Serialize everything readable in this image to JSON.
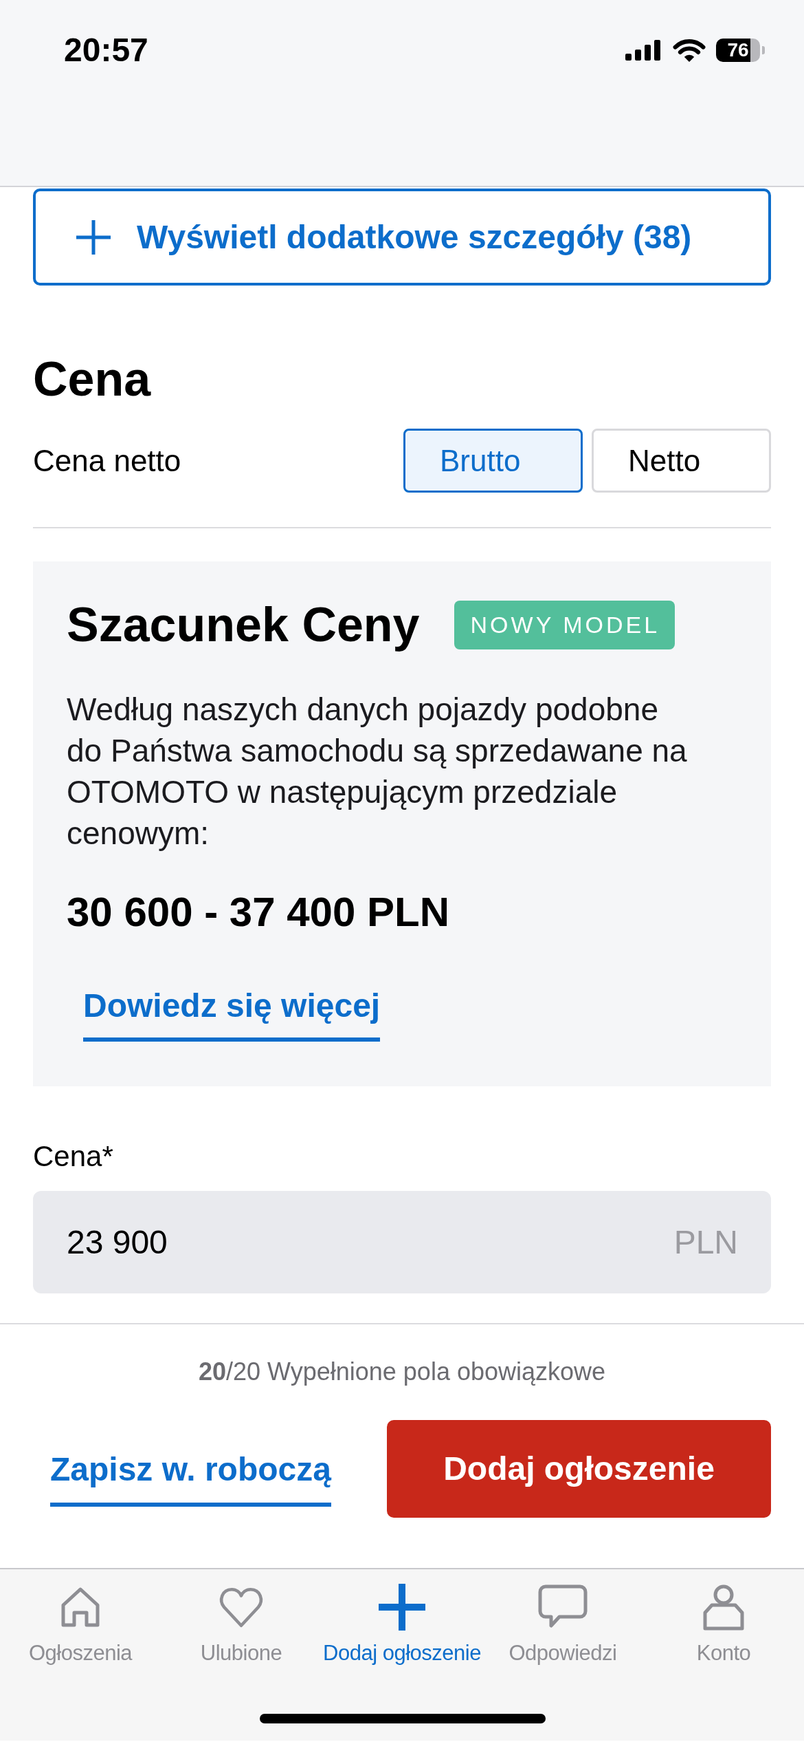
{
  "status_bar": {
    "time": "20:57",
    "battery": "76"
  },
  "details_button": {
    "label": "Wyświetl dodatkowe szczegóły (38)"
  },
  "price_section": {
    "title": "Cena",
    "net_price": {
      "label": "Cena netto",
      "options": [
        {
          "label": "Brutto",
          "selected": true
        },
        {
          "label": "Netto",
          "selected": false
        }
      ]
    }
  },
  "price_estimate": {
    "title": "Szacunek Ceny",
    "badge": "NOWY MODEL",
    "description": "Według naszych danych pojazdy podobne do Państwa samochodu są sprzedawane na OTOMOTO w następującym przedziale cenowym:",
    "range": "30 600 - 37 400 PLN",
    "link": "Dowiedz się więcej"
  },
  "price_field": {
    "label": "Cena*",
    "value": "23 900",
    "unit": "PLN"
  },
  "required_fields": "**20**/20 Wypełnione pola obowiązkowe",
  "actions": {
    "draft_link": "Zapisz w. roboczą",
    "submit_button": "Dodaj ogłoszenie"
  },
  "tab_bar": [
    {
      "label": "Ogłoszenia",
      "selected": false
    },
    {
      "label": "Ulubione",
      "selected": false
    },
    {
      "label": "Dodaj ogłoszenie",
      "selected": true
    },
    {
      "label": "Odpowiedzi",
      "selected": false
    },
    {
      "label": "Konto",
      "selected": false
    }
  ]
}
